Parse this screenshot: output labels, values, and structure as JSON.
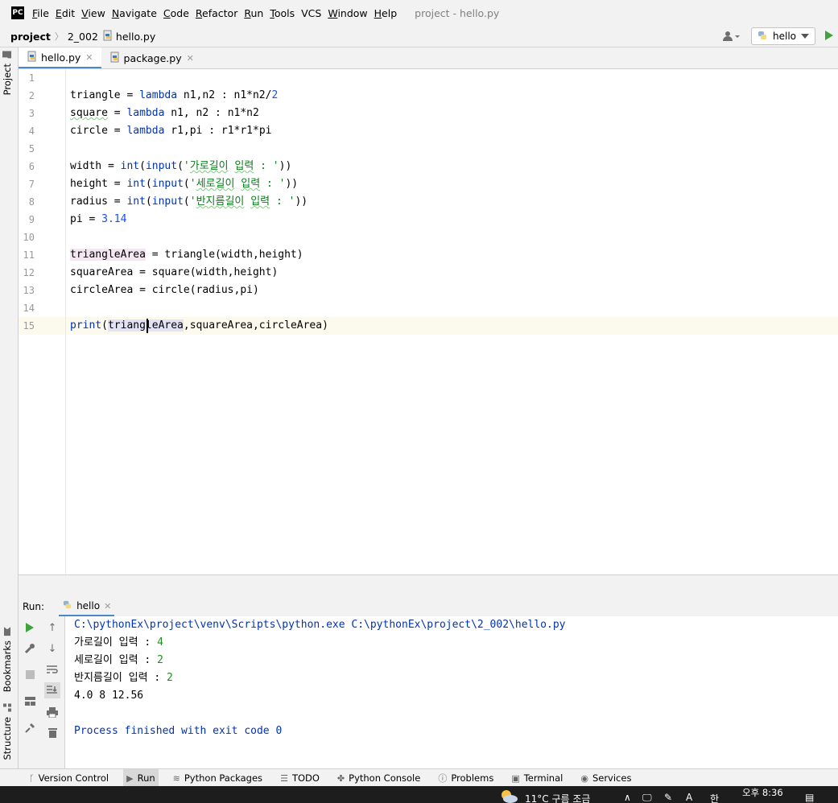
{
  "app": {
    "logo": "PC",
    "window_title": "project - hello.py"
  },
  "menu": [
    {
      "label": "File",
      "mnemonic": "F",
      "rest": "ile"
    },
    {
      "label": "Edit",
      "mnemonic": "E",
      "rest": "dit"
    },
    {
      "label": "View",
      "mnemonic": "V",
      "rest": "iew"
    },
    {
      "label": "Navigate",
      "mnemonic": "N",
      "rest": "avigate"
    },
    {
      "label": "Code",
      "mnemonic": "C",
      "rest": "ode"
    },
    {
      "label": "Refactor",
      "mnemonic": "R",
      "rest": "efactor"
    },
    {
      "label": "Run",
      "mnemonic": "R",
      "rest": "un"
    },
    {
      "label": "Tools",
      "mnemonic": "T",
      "rest": "ools"
    },
    {
      "label": "VCS",
      "mnemonic": "",
      "rest": "VCS"
    },
    {
      "label": "Window",
      "mnemonic": "W",
      "rest": "indow"
    },
    {
      "label": "Help",
      "mnemonic": "H",
      "rest": "elp"
    }
  ],
  "breadcrumb": {
    "project": "project",
    "folder": "2_002",
    "file": "hello.py"
  },
  "run_config": {
    "name": "hello"
  },
  "side_tabs": {
    "project": "Project",
    "bookmarks": "Bookmarks",
    "structure": "Structure"
  },
  "editor_tabs": [
    {
      "label": "hello.py",
      "active": true
    },
    {
      "label": "package.py",
      "active": false
    }
  ],
  "line_numbers": [
    "1",
    "2",
    "3",
    "4",
    "5",
    "6",
    "7",
    "8",
    "9",
    "10",
    "11",
    "12",
    "13",
    "14",
    "15"
  ],
  "run_panel": {
    "label": "Run:",
    "tab": "hello",
    "console": {
      "cmd": "C:\\pythonEx\\project\\venv\\Scripts\\python.exe C:\\pythonEx\\project\\2_002\\hello.py",
      "l1_prompt": "가로길이 입력 : ",
      "l1_val": "4",
      "l2_prompt": "세로길이 입력 : ",
      "l2_val": "2",
      "l3_prompt": "반지름길이 입력 : ",
      "l3_val": "2",
      "result": "4.0 8 12.56",
      "exit": "Process finished with exit code 0"
    }
  },
  "bottom_tabs": [
    "Version Control",
    "Run",
    "Python Packages",
    "TODO",
    "Python Console",
    "Problems",
    "Terminal",
    "Services"
  ],
  "taskbar": {
    "weather": "11°C 구름 조금",
    "time": "오후 8:36",
    "ime": "한"
  },
  "colors": {
    "keyword": "#0033b3",
    "string": "#067d17",
    "number": "#1750eb",
    "accent": "#4a88c7",
    "run_green": "#3fa23a"
  }
}
